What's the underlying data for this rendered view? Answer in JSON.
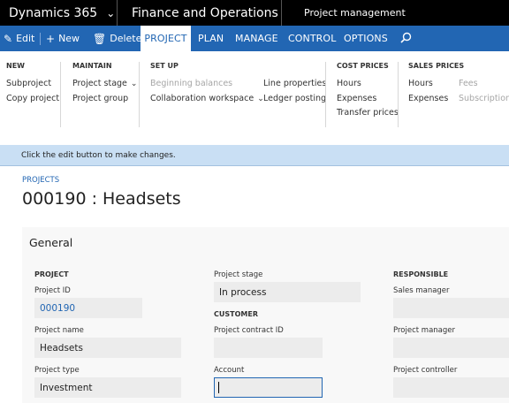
{
  "topbar": {
    "app_name": "Dynamics 365",
    "module": "Finance and Operations",
    "workspace": "Project management"
  },
  "actionbar": {
    "edit": "Edit",
    "new": "New",
    "delete": "Delete",
    "tabs": [
      "PROJECT",
      "PLAN",
      "MANAGE",
      "CONTROL",
      "OPTIONS"
    ],
    "active_tab": "PROJECT"
  },
  "ribbon": {
    "new": {
      "title": "NEW",
      "items": [
        "Subproject",
        "Copy project"
      ]
    },
    "maintain": {
      "title": "MAINTAIN",
      "items": [
        "Project stage",
        "Project group"
      ]
    },
    "setup": {
      "title": "SET UP",
      "col1": [
        "Beginning balances",
        "Collaboration workspace"
      ],
      "col2": [
        "Line properties",
        "Ledger posting"
      ]
    },
    "cost_prices": {
      "title": "COST PRICES",
      "items": [
        "Hours",
        "Expenses",
        "Transfer prices"
      ]
    },
    "sales_prices": {
      "title": "SALES PRICES",
      "col1": [
        "Hours",
        "Expenses"
      ],
      "col2": [
        "Fees",
        "Subscriptions"
      ]
    }
  },
  "message": "Click the edit button to make changes.",
  "breadcrumb": "PROJECTS",
  "page_title": "000190 : Headsets",
  "general": {
    "header": "General",
    "project_section": "PROJECT",
    "project_id_label": "Project ID",
    "project_id": "000190",
    "project_name_label": "Project name",
    "project_name": "Headsets",
    "project_type_label": "Project type",
    "project_type": "Investment",
    "project_stage_label": "Project stage",
    "project_stage": "In process",
    "customer_section": "CUSTOMER",
    "project_contract_label": "Project contract ID",
    "project_contract": "",
    "account_label": "Account",
    "account": "",
    "responsible_section": "RESPONSIBLE",
    "sales_manager_label": "Sales manager",
    "sales_manager": "",
    "project_manager_label": "Project manager",
    "project_manager": "",
    "project_controller_label": "Project controller",
    "project_controller": ""
  }
}
